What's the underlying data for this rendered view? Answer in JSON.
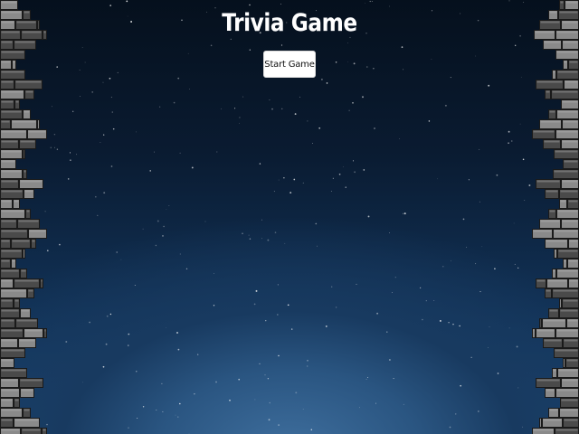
{
  "page": {
    "title": "Trivia Game",
    "start_button_label": "Start Game"
  },
  "theme": {
    "sky_top": "#05101d",
    "sky_bottom": "#1c4672",
    "glow": "#3f6f9e",
    "brick_light": "#8a8a8a",
    "brick_dark": "#4a4a4a",
    "mortar": "#1a1a1a",
    "button_bg": "#ffffff",
    "title_color": "#ffffff"
  },
  "decor": {
    "background": "starry-night-sky",
    "side_borders": "stone-brick-walls"
  }
}
